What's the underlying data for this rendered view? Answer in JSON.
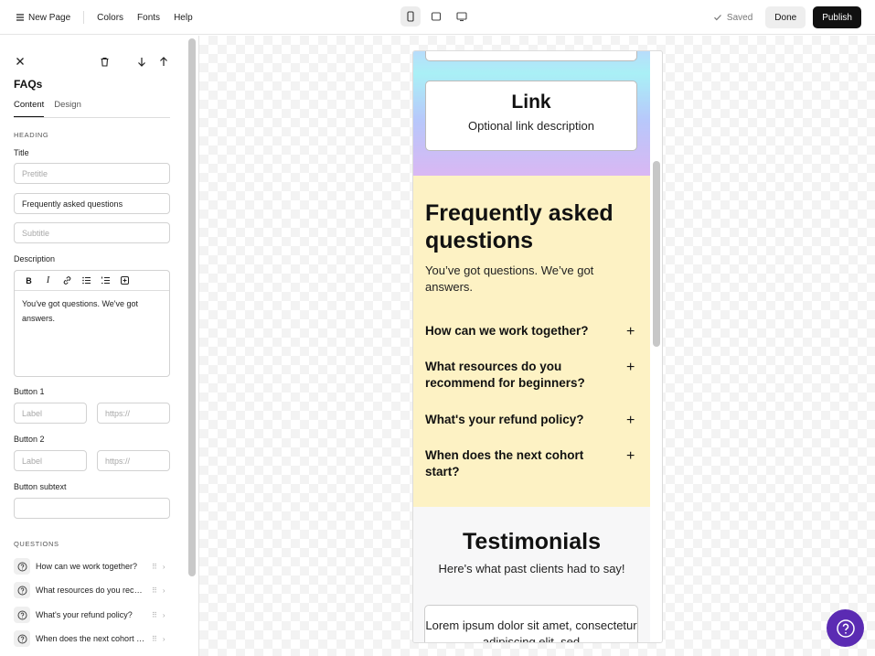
{
  "topbar": {
    "page_menu_label": "New Page",
    "colors_label": "Colors",
    "fonts_label": "Fonts",
    "help_label": "Help",
    "saved_label": "Saved",
    "done_label": "Done",
    "publish_label": "Publish"
  },
  "sidebar": {
    "title": "FAQs",
    "tabs": [
      "Content",
      "Design"
    ],
    "heading_section": "HEADING",
    "title_label": "Title",
    "pretitle_placeholder": "Pretitle",
    "title_value": "Frequently asked questions",
    "subtitle_placeholder": "Subtitle",
    "description_label": "Description",
    "description_value": "You've got questions. We've got answers.",
    "button1_label": "Button 1",
    "button2_label": "Button 2",
    "label_placeholder": "Label",
    "url_placeholder": "https://",
    "button_subtext_label": "Button subtext",
    "questions_section": "QUESTIONS",
    "questions": [
      "How can we work together?",
      "What resources do you recommend for beginners?",
      "What's your refund policy?",
      "When does the next cohort start?"
    ]
  },
  "preview": {
    "link_title": "Link",
    "link_description": "Optional link description",
    "faq_heading": "Frequently asked questions",
    "faq_subheading": "You’ve got questions. We’ve got answers.",
    "faq_questions": [
      "How can we work together?",
      "What resources do you recommend for beginners?",
      "What's your refund policy?",
      "When does the next cohort start?"
    ],
    "testimonials_heading": "Testimonials",
    "testimonials_subheading": "Here's what past clients had to say!",
    "testimonial_text": "Lorem ipsum dolor sit amet, consectetur adipiscing elit, sed"
  },
  "colors": {
    "accent": "#111111",
    "faq_background": "#fdf2c4",
    "help_button": "#5b2bb3"
  },
  "icons": [
    "menu-icon",
    "phone-icon",
    "tablet-icon",
    "desktop-icon",
    "check-icon",
    "close-icon",
    "trash-icon",
    "arrow-down-icon",
    "arrow-up-icon",
    "bold-icon",
    "italic-icon",
    "link-icon",
    "bullet-list-icon",
    "numbered-list-icon",
    "embed-icon",
    "question-icon",
    "drag-handle-icon",
    "chevron-right-icon",
    "plus-icon",
    "help-icon"
  ]
}
